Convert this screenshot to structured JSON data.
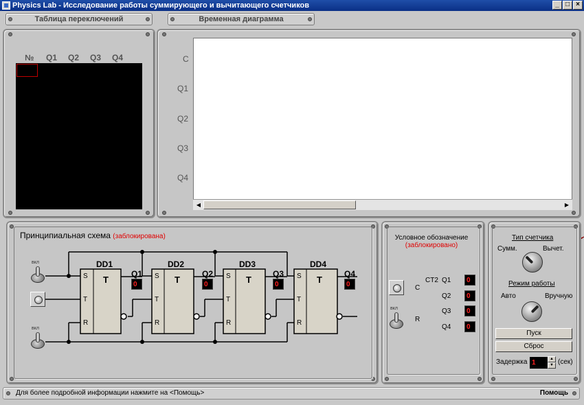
{
  "window": {
    "title": "Physics Lab - Исследование работы суммирующего и вычитающего счетчиков",
    "buttons": {
      "minimize": "_",
      "maximize": "□",
      "close": "×"
    }
  },
  "switch_table": {
    "tab_label": "Таблица переключений",
    "columns": [
      "№",
      "Q1",
      "Q2",
      "Q3",
      "Q4"
    ]
  },
  "timing": {
    "tab_label": "Временная диаграмма",
    "signals": [
      "C",
      "Q1",
      "Q2",
      "Q3",
      "Q4"
    ]
  },
  "schema": {
    "title": "Принципиальная схема",
    "locked": "(заблокирована)",
    "toggle_label": "вкл",
    "flipflops": [
      {
        "name": "DD1",
        "output": "Q1",
        "value": "0"
      },
      {
        "name": "DD2",
        "output": "Q2",
        "value": "0"
      },
      {
        "name": "DD3",
        "output": "Q3",
        "value": "0"
      },
      {
        "name": "DD4",
        "output": "Q4",
        "value": "0"
      }
    ],
    "pins": {
      "s": "S",
      "t": "T",
      "r": "R",
      "mid": "T"
    }
  },
  "legend": {
    "title": "Условное обозначение",
    "locked": "(заблокировано)",
    "chip": "CT2",
    "pin_c": "C",
    "pin_r": "R",
    "toggle_label": "вкл",
    "outputs": [
      {
        "name": "Q1",
        "value": "0"
      },
      {
        "name": "Q2",
        "value": "0"
      },
      {
        "name": "Q3",
        "value": "0"
      },
      {
        "name": "Q4",
        "value": "0"
      }
    ]
  },
  "controls": {
    "counter_type_label": "Тип счетчика",
    "sum_label": "Сумм.",
    "sub_label": "Вычет.",
    "mode_label": "Режим работы",
    "auto_label": "Авто",
    "manual_label": "Вручную",
    "start_button": "Пуск",
    "reset_button": "Сброс",
    "delay_label": "Задержка",
    "delay_value": "1",
    "delay_unit": "(сек)"
  },
  "status": {
    "message": "Для более подробной информации нажмите на <Помощь>",
    "help": "Помощь"
  }
}
